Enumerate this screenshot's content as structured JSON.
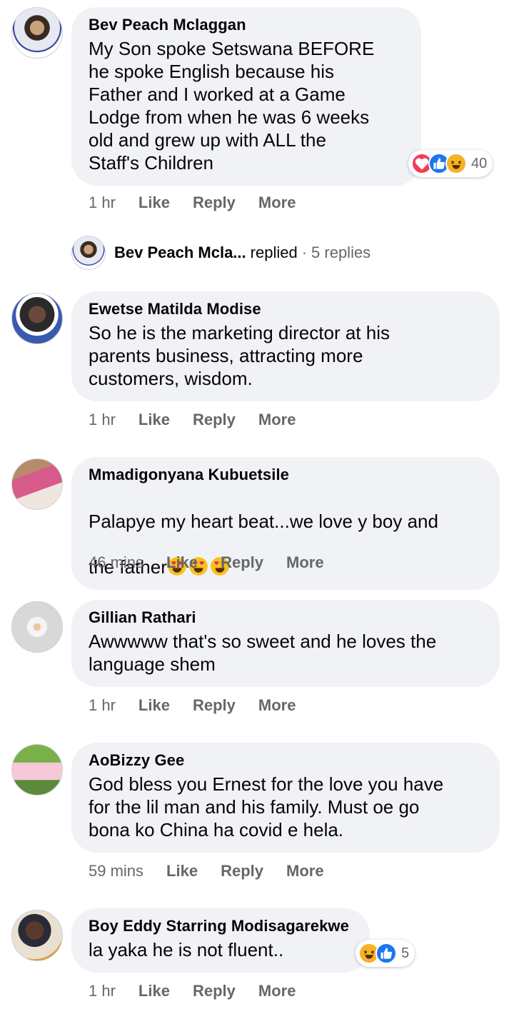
{
  "comments": [
    {
      "author": "Bev Peach Mclaggan",
      "text": "My Son spoke Setswana BEFORE\nhe spoke English because his\nFather and I worked at a Game\nLodge from when he was 6 weeks\nold and grew up with ALL the\nStaff's Children",
      "time": "1 hr",
      "reaction_count": "40"
    },
    {
      "author": "Ewetse Matilda Modise",
      "text": "So he is the marketing director at his\nparents business, attracting more\ncustomers, wisdom.",
      "time": "1 hr"
    },
    {
      "author": "Mmadigonyana Kubuetsile",
      "text_line1": "Palapye my heart beat...we love y boy and",
      "text_line2": "the father",
      "time": "46 mins"
    },
    {
      "author": "Gillian Rathari",
      "text": "Awwwww that's so sweet and he loves the\nlanguage shem",
      "time": "1 hr"
    },
    {
      "author": "AoBizzy Gee",
      "text": "God bless you Ernest for the love you have\nfor the lil man and his family. Must oe go\nbona ko China ha covid e hela.",
      "time": "59 mins"
    },
    {
      "author": "Boy Eddy Starring Modisagarekwe",
      "text": "la yaka he is not fluent..",
      "time": "1 hr",
      "reaction_count": "5"
    }
  ],
  "actions": {
    "like": "Like",
    "reply": "Reply",
    "more": "More"
  },
  "replies": {
    "name": "Bev Peach Mcla...",
    "verb": "replied",
    "dot": "·",
    "count": "5 replies"
  },
  "colors": {
    "bubble": "#f0f2f5",
    "meta": "#65676b",
    "like_blue": "#1877f2",
    "love_red": "#f33e58",
    "haha_yellow": "#f7b125"
  }
}
